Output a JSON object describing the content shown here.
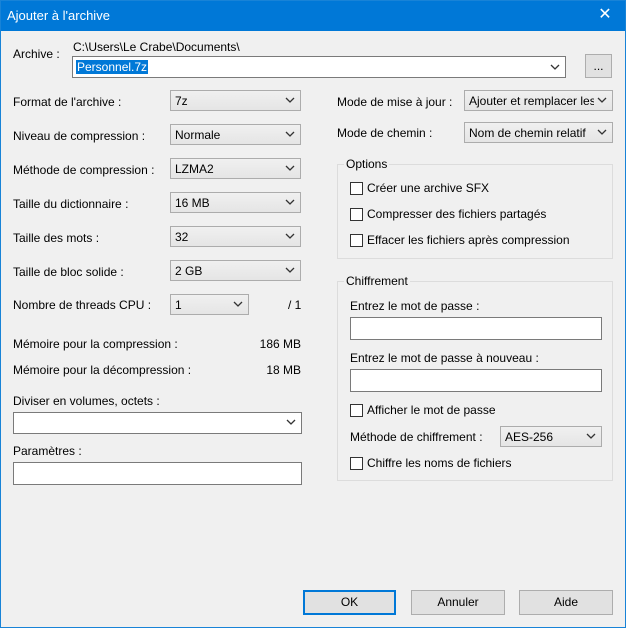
{
  "window": {
    "title": "Ajouter à l'archive",
    "close": "✕"
  },
  "archive": {
    "label": "Archive :",
    "path": "C:\\Users\\Le Crabe\\Documents\\",
    "filename": "Personnel.7z",
    "browse_label": "..."
  },
  "left": {
    "format_label": "Format de l'archive :",
    "format_value": "7z",
    "level_label": "Niveau de compression :",
    "level_value": "Normale",
    "method_label": "Méthode de compression :",
    "method_value": "LZMA2",
    "dict_label": "Taille du dictionnaire :",
    "dict_value": "16 MB",
    "word_label": "Taille des mots :",
    "word_value": "32",
    "solid_label": "Taille de bloc solide :",
    "solid_value": "2 GB",
    "threads_label": "Nombre de threads CPU :",
    "threads_value": "1",
    "threads_total": "/ 1",
    "mem_comp_label": "Mémoire pour la compression :",
    "mem_comp_value": "186 MB",
    "mem_decomp_label": "Mémoire pour la décompression :",
    "mem_decomp_value": "18 MB",
    "split_label": "Diviser en volumes, octets :",
    "split_value": "",
    "params_label": "Paramètres :",
    "params_value": ""
  },
  "right": {
    "update_label": "Mode de mise à jour :",
    "update_value": "Ajouter et remplacer les fichiers",
    "path_label": "Mode de chemin :",
    "path_value": "Nom de chemin relatif",
    "options": {
      "legend": "Options",
      "sfx": "Créer une archive SFX",
      "shared": "Compresser des fichiers partagés",
      "delete": "Effacer les fichiers après compression"
    },
    "encryption": {
      "legend": "Chiffrement",
      "pwd_label": "Entrez le mot de passe :",
      "pwd2_label": "Entrez le mot de passe à nouveau :",
      "show_pwd": "Afficher le mot de passe",
      "method_label": "Méthode de chiffrement :",
      "method_value": "AES-256",
      "encrypt_names": "Chiffre les noms de fichiers"
    }
  },
  "buttons": {
    "ok": "OK",
    "cancel": "Annuler",
    "help": "Aide"
  }
}
